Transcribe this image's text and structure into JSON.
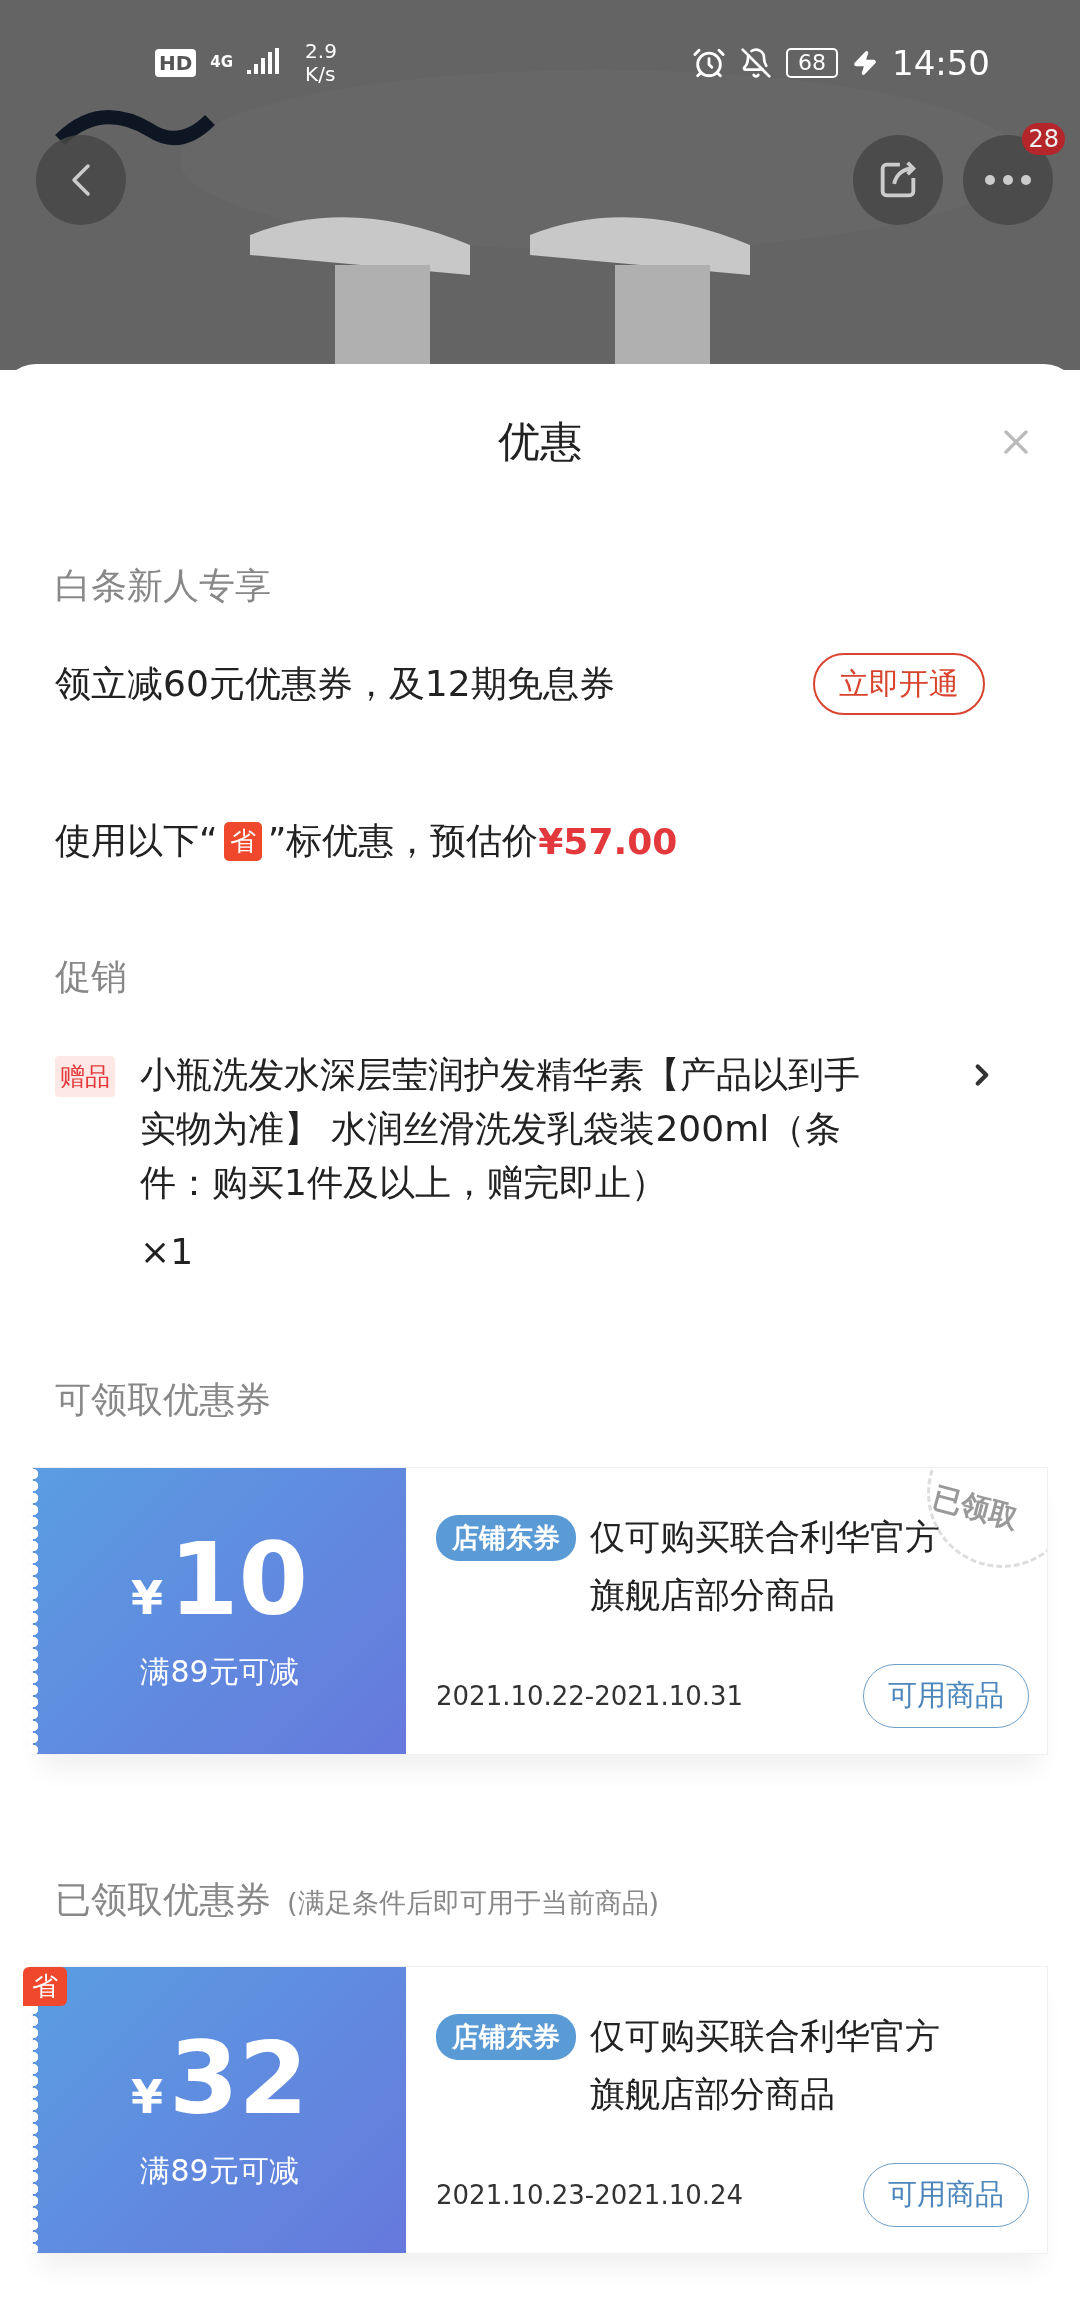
{
  "status_bar": {
    "hd": "HD",
    "network": "4G",
    "speed_value": "2.9",
    "speed_unit": "K/s",
    "battery": "68",
    "charging": true,
    "time": "14:50"
  },
  "top_bar": {
    "more_badge": "28"
  },
  "sheet": {
    "title": "优惠",
    "baitiao": {
      "heading": "白条新人专享",
      "offer": "领立减60元优惠券，及12期免息券",
      "button": "立即开通"
    },
    "estimate": {
      "prefix": "使用以下“",
      "badge": "省",
      "suffix": "”标优惠，预估价",
      "price": "¥57.00"
    },
    "promotion": {
      "heading": "促销",
      "tag": "赠品",
      "text": "小瓶洗发水深层莹润护发精华素【产品以到手实物为准】 水润丝滑洗发乳袋装200ml（条件：购买1件及以上，赠完即止）",
      "quantity": "×1"
    },
    "coupon_sections": [
      {
        "heading": "可领取优惠券",
        "coupons": [
          {
            "currency": "¥",
            "amount": "10",
            "condition": "满89元可减",
            "tag": "店铺东券",
            "description": "仅可购买联合利华官方旗舰店部分商品",
            "dates": "2021.10.22-2021.10.31",
            "button": "可用商品",
            "stamp": "已领取"
          }
        ]
      },
      {
        "heading": "已领取优惠券",
        "note": "(满足条件后即可用于当前商品)",
        "coupons": [
          {
            "currency": "¥",
            "amount": "32",
            "condition": "满89元可减",
            "tag": "店铺东券",
            "description": "仅可购买联合利华官方旗舰店部分商品",
            "dates": "2021.10.23-2021.10.24",
            "button": "可用商品",
            "badge": "省"
          }
        ]
      }
    ]
  }
}
